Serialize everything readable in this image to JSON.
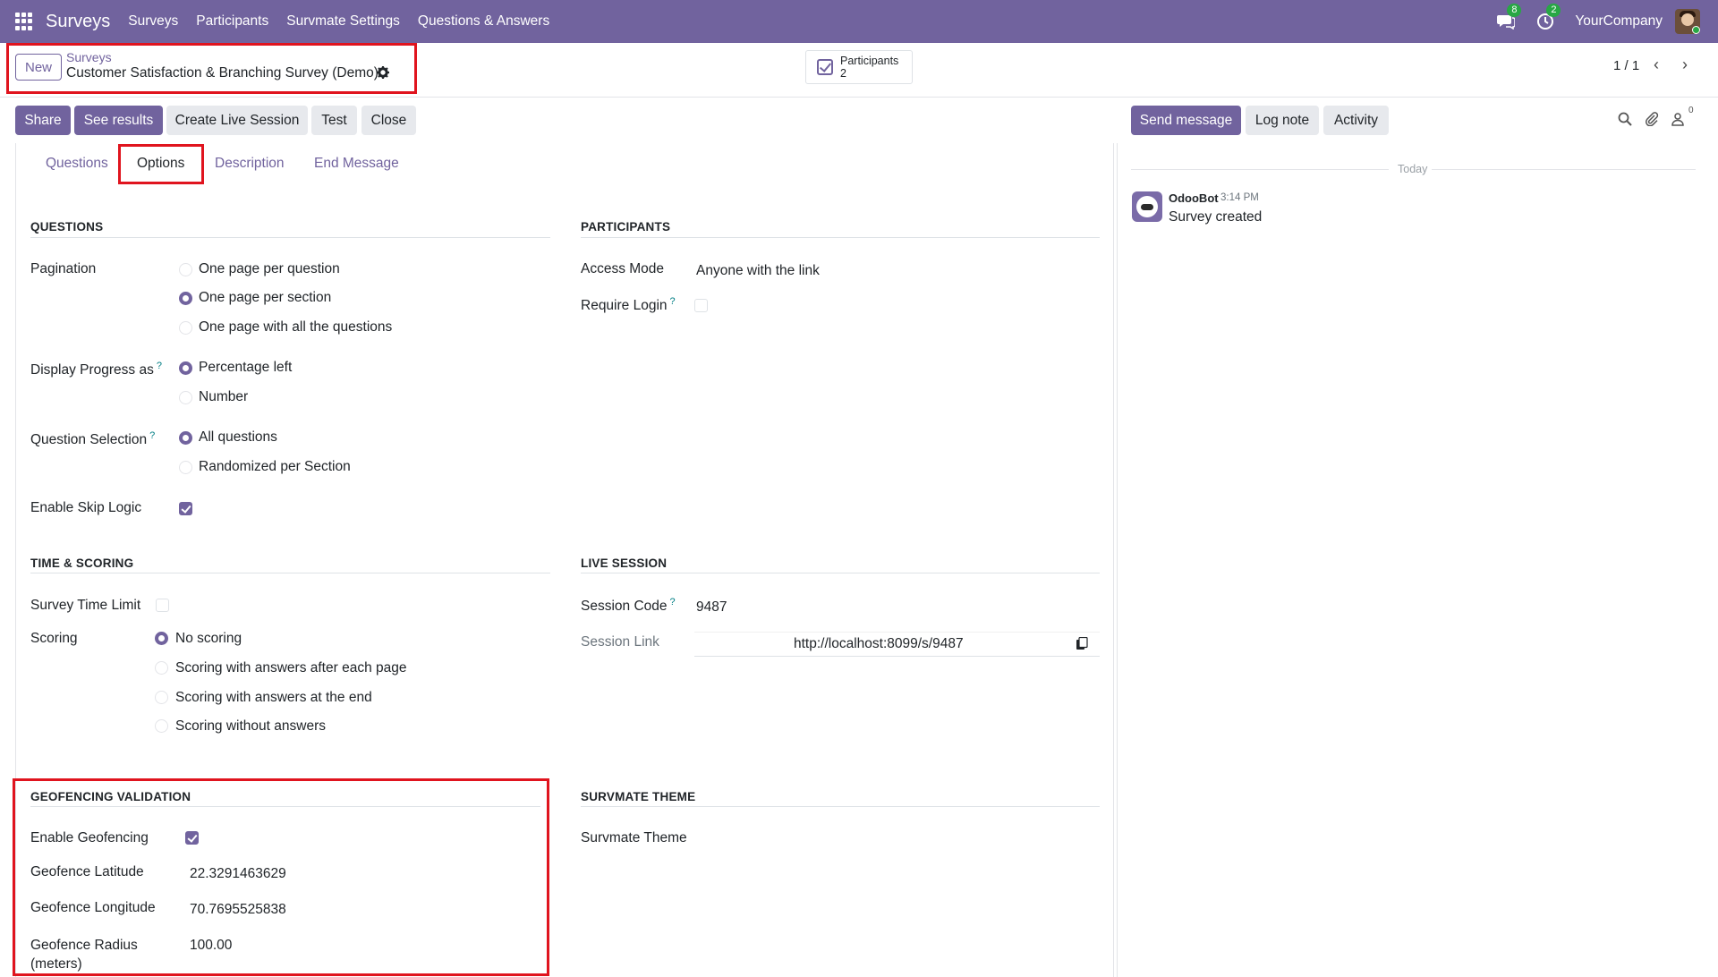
{
  "navbar": {
    "app_name": "Surveys",
    "menu": [
      "Surveys",
      "Participants",
      "Survmate Settings",
      "Questions & Answers"
    ],
    "messages_badge": "8",
    "activities_badge": "2",
    "company": "YourCompany"
  },
  "control": {
    "new_label": "New",
    "breadcrumb_parent": "Surveys",
    "breadcrumb_current": "Customer Satisfaction & Branching Survey (Demo)",
    "stat_label": "Participants",
    "stat_value": "2",
    "pager": "1 / 1"
  },
  "actions": {
    "share": "Share",
    "see_results": "See results",
    "create_live_session": "Create Live Session",
    "test": "Test",
    "close": "Close"
  },
  "tabs": [
    "Questions",
    "Options",
    "Description",
    "End Message"
  ],
  "active_tab": "Options",
  "questions": {
    "title": "QUESTIONS",
    "pagination_label": "Pagination",
    "pagination_options": [
      "One page per question",
      "One page per section",
      "One page with all the questions"
    ],
    "pagination_selected": 1,
    "progress_label": "Display Progress as",
    "progress_options": [
      "Percentage left",
      "Number"
    ],
    "progress_selected": 0,
    "selection_label": "Question Selection",
    "selection_options": [
      "All questions",
      "Randomized per Section"
    ],
    "selection_selected": 0,
    "skip_logic_label": "Enable Skip Logic",
    "skip_logic_checked": true,
    "help_mark": "?"
  },
  "participants": {
    "title": "PARTICIPANTS",
    "access_label": "Access Mode",
    "access_value": "Anyone with the link",
    "login_label": "Require Login",
    "login_checked": false
  },
  "time_scoring": {
    "title": "TIME & SCORING",
    "time_limit_label": "Survey Time Limit",
    "time_limit_checked": false,
    "scoring_label": "Scoring",
    "scoring_options": [
      "No scoring",
      "Scoring with answers after each page",
      "Scoring with answers at the end",
      "Scoring without answers"
    ],
    "scoring_selected": 0
  },
  "live_session": {
    "title": "LIVE SESSION",
    "code_label": "Session Code",
    "code_value": "9487",
    "link_label": "Session Link",
    "link_value": "http://localhost:8099/s/9487"
  },
  "geofencing": {
    "title": "GEOFENCING VALIDATION",
    "enable_label": "Enable Geofencing",
    "enable_checked": true,
    "lat_label": "Geofence Latitude",
    "lat_value": "22.3291463629",
    "lng_label": "Geofence Longitude",
    "lng_value": "70.7695525838",
    "radius_label_1": "Geofence Radius",
    "radius_label_2": "(meters)",
    "radius_value": "100.00"
  },
  "theme": {
    "title": "SURVMATE THEME",
    "theme_label": "Survmate Theme"
  },
  "chatter": {
    "send_message": "Send message",
    "log_note": "Log note",
    "activity": "Activity",
    "followers_count": "0",
    "day_label": "Today",
    "author": "OdooBot",
    "time": "3:14 PM",
    "message": "Survey created"
  },
  "colors": {
    "brand": "#71639e",
    "highlight": "#e0141e",
    "badge": "#28a745"
  }
}
